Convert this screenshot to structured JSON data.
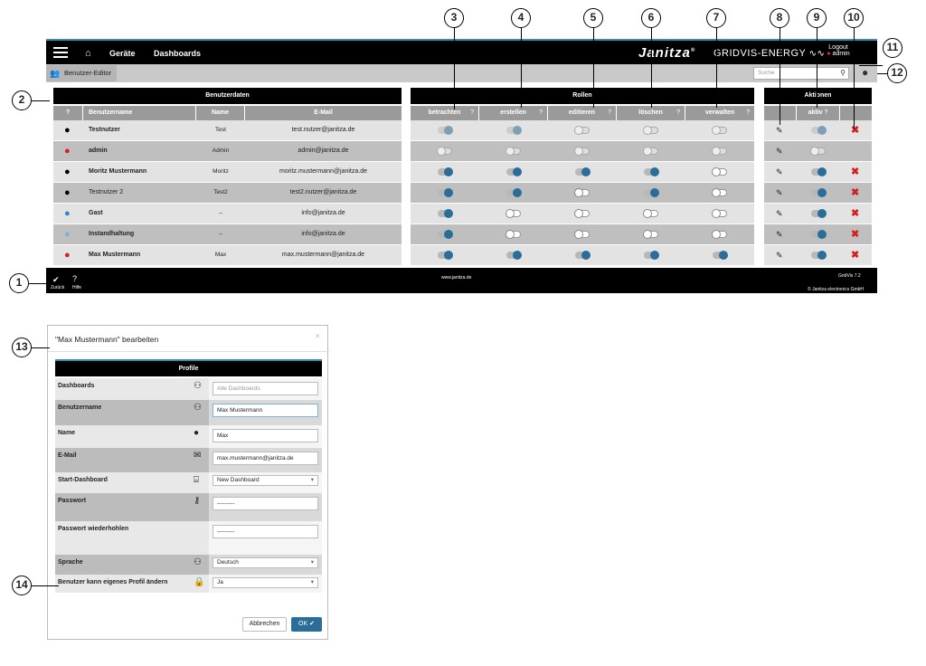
{
  "topbar": {
    "home_icon": "home-icon",
    "nav": [
      "Geräte",
      "Dashboards"
    ],
    "logo": "Janitza",
    "logo_mark": "®",
    "product": "GRIDVIS-ENERGY",
    "logout": "Logout",
    "user": "admin"
  },
  "subbar": {
    "tab": "Benutzer-Editor",
    "search_placeholder": "Suche"
  },
  "panels": {
    "benutzerdaten": "Benutzerdaten",
    "rollen": "Rollen",
    "aktionen": "Aktionen"
  },
  "columns": {
    "help": "?",
    "user": [
      "Benutzername",
      "Name",
      "E-Mail"
    ],
    "roles": [
      "betrachten",
      "erstellen",
      "editieren",
      "löschen",
      "verwalten"
    ],
    "actions": [
      "aktiv"
    ]
  },
  "users": [
    {
      "username": "Testnutzer",
      "name": "Test",
      "email": "test.nutzer@janitza.de",
      "color": "#000000",
      "bold": true
    },
    {
      "username": "admin",
      "name": "Admin",
      "email": "admin@janitza.de",
      "color": "#d42020",
      "bold": true
    },
    {
      "username": "Moritz Mustermann",
      "name": "Moritz",
      "email": "moritz.mustermann@janitza.de",
      "color": "#000000",
      "bold": true
    },
    {
      "username": "Testnutzer 2",
      "name": "Test2",
      "email": "test2.nutzer@janitza.de",
      "color": "#000000",
      "bold": false
    },
    {
      "username": "Gast",
      "name": "--",
      "email": "info@janitza.de",
      "color": "#3a7fc4",
      "bold": true
    },
    {
      "username": "Instandhaltung",
      "name": "--",
      "email": "info@janitza.de",
      "color": "#7fb0d8",
      "bold": true
    },
    {
      "username": "Max Mustermann",
      "name": "Max",
      "email": "max.mustermann@janitza.de",
      "color": "#d42020",
      "bold": true
    }
  ],
  "roles_state": [
    [
      "ondis",
      "ondis",
      "dis",
      "dis",
      "dis"
    ],
    [
      "dis",
      "dis",
      "dis",
      "dis",
      "dis"
    ],
    [
      "on",
      "on",
      "on",
      "on",
      "off"
    ],
    [
      "on",
      "on",
      "off",
      "on",
      "off"
    ],
    [
      "on",
      "off",
      "off",
      "off",
      "off"
    ],
    [
      "on",
      "off",
      "off",
      "off",
      "off"
    ],
    [
      "on",
      "on",
      "on",
      "on",
      "on"
    ]
  ],
  "aktiv_state": [
    "ondis",
    "dis",
    "on",
    "on",
    "on",
    "on",
    "on"
  ],
  "deletable": [
    true,
    false,
    true,
    true,
    true,
    true,
    true
  ],
  "footer": {
    "back": "Zurück",
    "help": "Hilfe",
    "url": "www.janitza.de",
    "version": "GridVis 7.2",
    "copyright": "© Janitza electronics GmbH"
  },
  "callouts": [
    "1",
    "2",
    "3",
    "4",
    "5",
    "6",
    "7",
    "8",
    "9",
    "10",
    "11",
    "12",
    "13",
    "14"
  ],
  "modal": {
    "title": "\"Max Mustermann\" bearbeiten",
    "close": "×",
    "section": "Profile",
    "fields": [
      {
        "label": "Dashboards",
        "value": "",
        "placeholder": "Alle Dashboards",
        "icon": "dashboards-user-icon",
        "type": "input"
      },
      {
        "label": "Benutzername",
        "value": "Max Mustermann",
        "icon": "user-settings-icon",
        "type": "input"
      },
      {
        "label": "Name",
        "value": "Max",
        "icon": "person-icon",
        "type": "input"
      },
      {
        "label": "E-Mail",
        "value": "max.mustermann@janitza.de",
        "icon": "envelope-icon",
        "type": "input"
      },
      {
        "label": "Start-Dashboard",
        "value": "New Dashboard",
        "icon": "easel-icon",
        "type": "select"
      },
      {
        "label": "Passwort",
        "value": "---------",
        "icon": "key-icon",
        "type": "input"
      },
      {
        "label": "Passwort wiederhohlen",
        "value": "---------",
        "icon": "",
        "type": "input"
      },
      {
        "label": "Sprache",
        "value": "Deutsch",
        "icon": "language-user-icon",
        "type": "select"
      },
      {
        "label": "Benutzer kann eigenes Profil ändern",
        "value": "Ja",
        "icon": "lock-icon",
        "type": "select"
      }
    ],
    "cancel": "Abbrechen",
    "ok": "OK"
  }
}
